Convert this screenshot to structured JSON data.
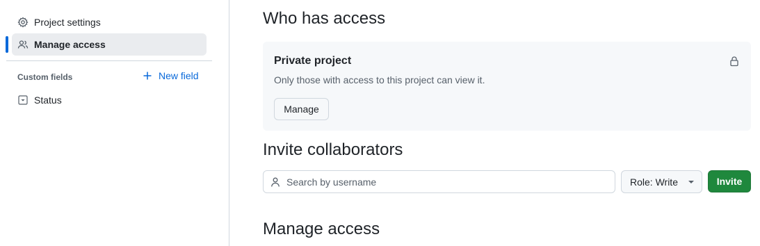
{
  "sidebar": {
    "items": [
      {
        "label": "Project settings",
        "icon": "gear-icon"
      },
      {
        "label": "Manage access",
        "icon": "people-icon",
        "active": true
      }
    ],
    "custom_fields_label": "Custom fields",
    "new_field_label": "New field",
    "fields": [
      {
        "label": "Status",
        "icon": "single-select-icon"
      }
    ]
  },
  "main": {
    "who_has_access_heading": "Who has access",
    "access_box": {
      "title": "Private project",
      "description": "Only those with access to this project can view it.",
      "manage_label": "Manage",
      "icon": "lock-icon"
    },
    "invite_heading": "Invite collaborators",
    "search": {
      "placeholder": "Search by username",
      "value": ""
    },
    "role_label": "Role: Write",
    "invite_label": "Invite",
    "manage_access_heading": "Manage access"
  },
  "colors": {
    "accent": "#0969da",
    "primary_button": "#1f883d",
    "active_nav_bg": "#eaecef",
    "panel_bg": "#f6f8fa"
  }
}
